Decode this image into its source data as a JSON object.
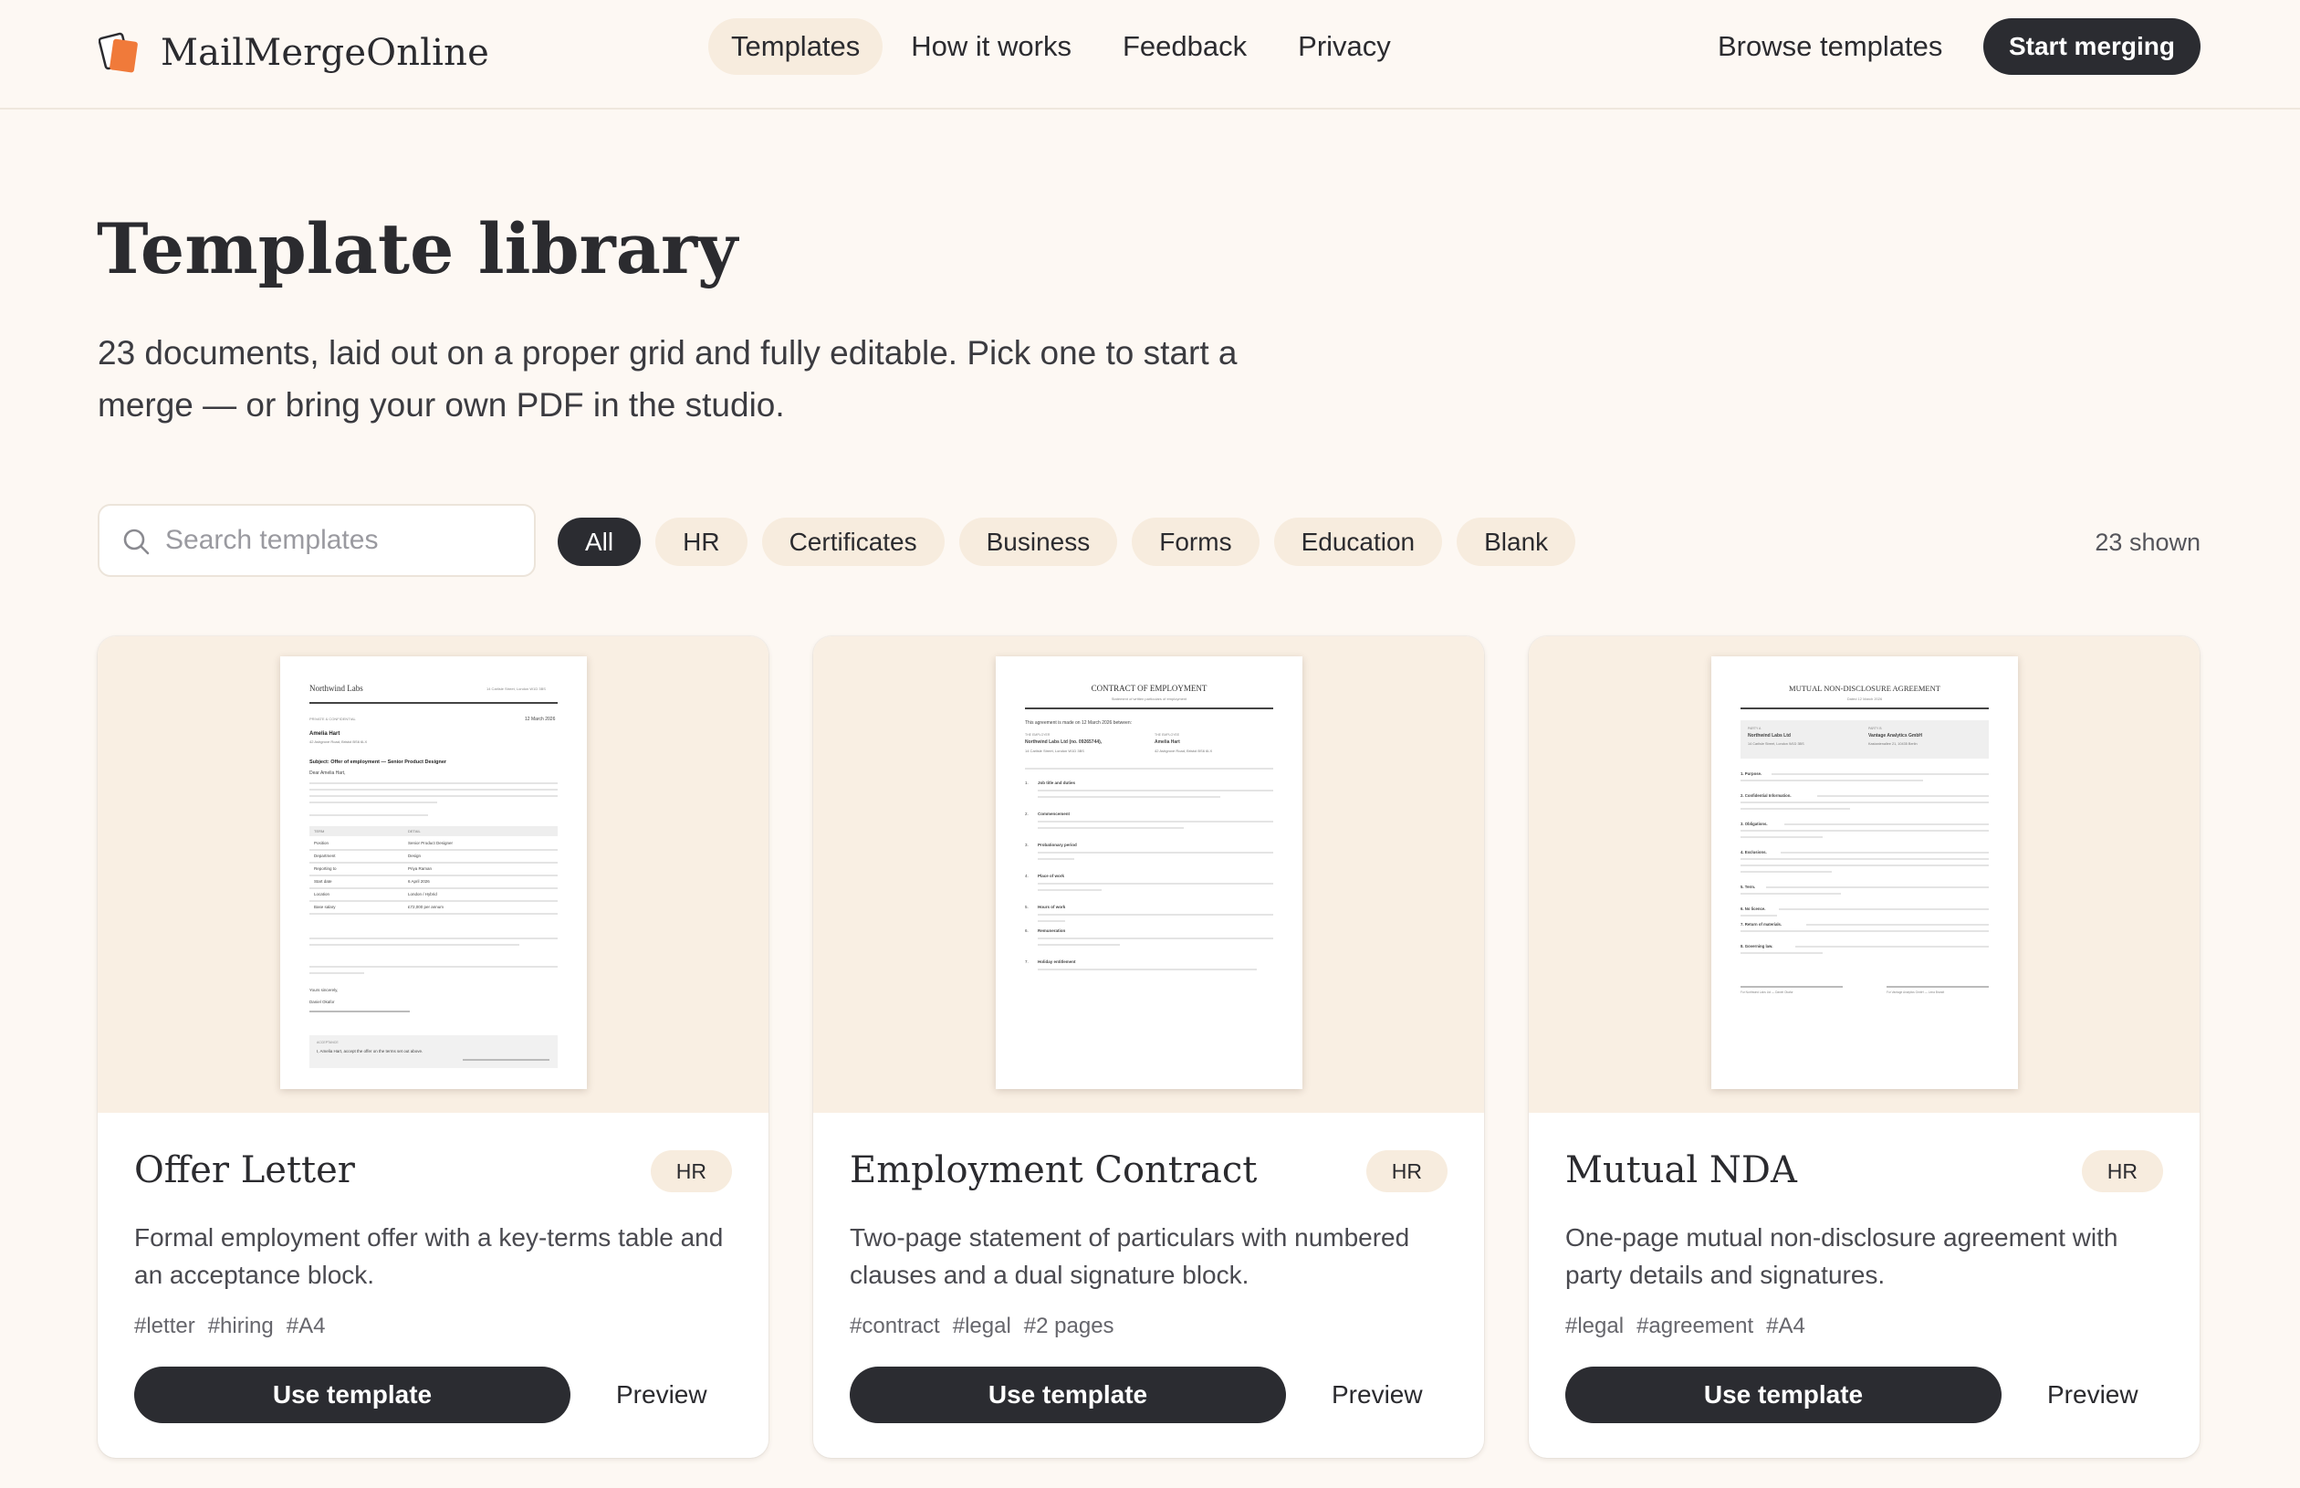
{
  "brand": {
    "name": "MailMergeOnline",
    "logo_icon": "stacked-papers-icon",
    "logo_color": "#f07a3a"
  },
  "nav": {
    "items": [
      "Templates",
      "How it works",
      "Feedback",
      "Privacy"
    ],
    "active": "Templates"
  },
  "header": {
    "browse_label": "Browse templates",
    "start_label": "Start merging"
  },
  "hero": {
    "title": "Template library",
    "subtitle": "23 documents, laid out on a proper grid and fully editable. Pick one to start a merge — or bring your own PDF in the studio."
  },
  "filters": {
    "search_placeholder": "Search templates",
    "search_value": "",
    "chips": [
      "All",
      "HR",
      "Certificates",
      "Business",
      "Forms",
      "Education",
      "Blank"
    ],
    "active_chip": "All",
    "shown_label": "23 shown"
  },
  "cards": [
    {
      "title": "Offer Letter",
      "badge": "HR",
      "description": "Formal employment offer with a key-terms table and an acceptance block.",
      "tags": [
        "#letter",
        "#hiring",
        "#A4"
      ],
      "use_label": "Use template",
      "preview_label": "Preview",
      "doc": {
        "company": "Northwind Labs",
        "address": "14 Carlisle Street, London W1D 3BS",
        "ref": "PRIVATE & CONFIDENTIAL",
        "date": "12 March 2026",
        "recipient": "Amelia Hart",
        "recipient_addr": "42 Ashgrove Road, Bristol BS6 6LX",
        "subject": "Subject: Offer of employment — Senior Product Designer",
        "greeting": "Dear Amelia Hart,",
        "table_head": [
          "TERM",
          "DETAIL"
        ],
        "table_rows": [
          [
            "Position",
            "Senior Product Designer"
          ],
          [
            "Department",
            "Design"
          ],
          [
            "Reporting to",
            "Priya Raman"
          ],
          [
            "Start date",
            "6 April 2026"
          ],
          [
            "Location",
            "London / Hybrid"
          ],
          [
            "Base salary",
            "£72,000 per annum"
          ]
        ],
        "closing": "Yours sincerely,",
        "signer": "Daniel Okafor",
        "accept_label": "ACCEPTANCE",
        "accept_text": "I, Amelia Hart, accept the offer on the terms set out above."
      }
    },
    {
      "title": "Employment Contract",
      "badge": "HR",
      "description": "Two-page statement of particulars with numbered clauses and a dual signature block.",
      "tags": [
        "#contract",
        "#legal",
        "#2 pages"
      ],
      "use_label": "Use template",
      "preview_label": "Preview",
      "doc": {
        "heading": "CONTRACT OF EMPLOYMENT",
        "subheading": "Statement of written particulars of employment",
        "intro": "This agreement is made on 12 March 2026 between:",
        "party1_label": "THE EMPLOYER",
        "party1_name": "Northwind Labs Ltd (no. 09265744),",
        "party1_addr": "14 Carlisle Street, London W1D 3BS",
        "party2_label": "THE EMPLOYEE",
        "party2_name": "Amelia Hart",
        "party2_addr": "42 Ashgrove Road, Bristol BS6 6LX",
        "clauses": [
          "Job title and duties",
          "Commencement",
          "Probationary period",
          "Place of work",
          "Hours of work",
          "Remuneration",
          "Holiday entitlement"
        ]
      }
    },
    {
      "title": "Mutual NDA",
      "badge": "HR",
      "description": "One-page mutual non-disclosure agreement with party details and signatures.",
      "tags": [
        "#legal",
        "#agreement",
        "#A4"
      ],
      "use_label": "Use template",
      "preview_label": "Preview",
      "doc": {
        "heading": "MUTUAL NON-DISCLOSURE AGREEMENT",
        "subheading": "Dated 12 March 2026",
        "party_a_label": "PARTY A",
        "party_a_name": "Northwind Labs Ltd",
        "party_a_addr": "14 Carlisle Street, London W1D 3BS",
        "party_b_label": "PARTY B",
        "party_b_name": "Vantage Analytics GmbH",
        "party_b_addr": "Kastanienallee 21, 10435 Berlin",
        "clauses": [
          "1. Purpose.",
          "2. Confidential Information.",
          "3. Obligations.",
          "4. Exclusions.",
          "5. Term.",
          "6. No licence.",
          "7. Return of materials.",
          "8. Governing law."
        ],
        "sig_a": "For Northwind Labs Ltd — Daniel Okafor",
        "sig_b": "For Vantage Analytics GmbH — Lena Brandt"
      }
    }
  ]
}
